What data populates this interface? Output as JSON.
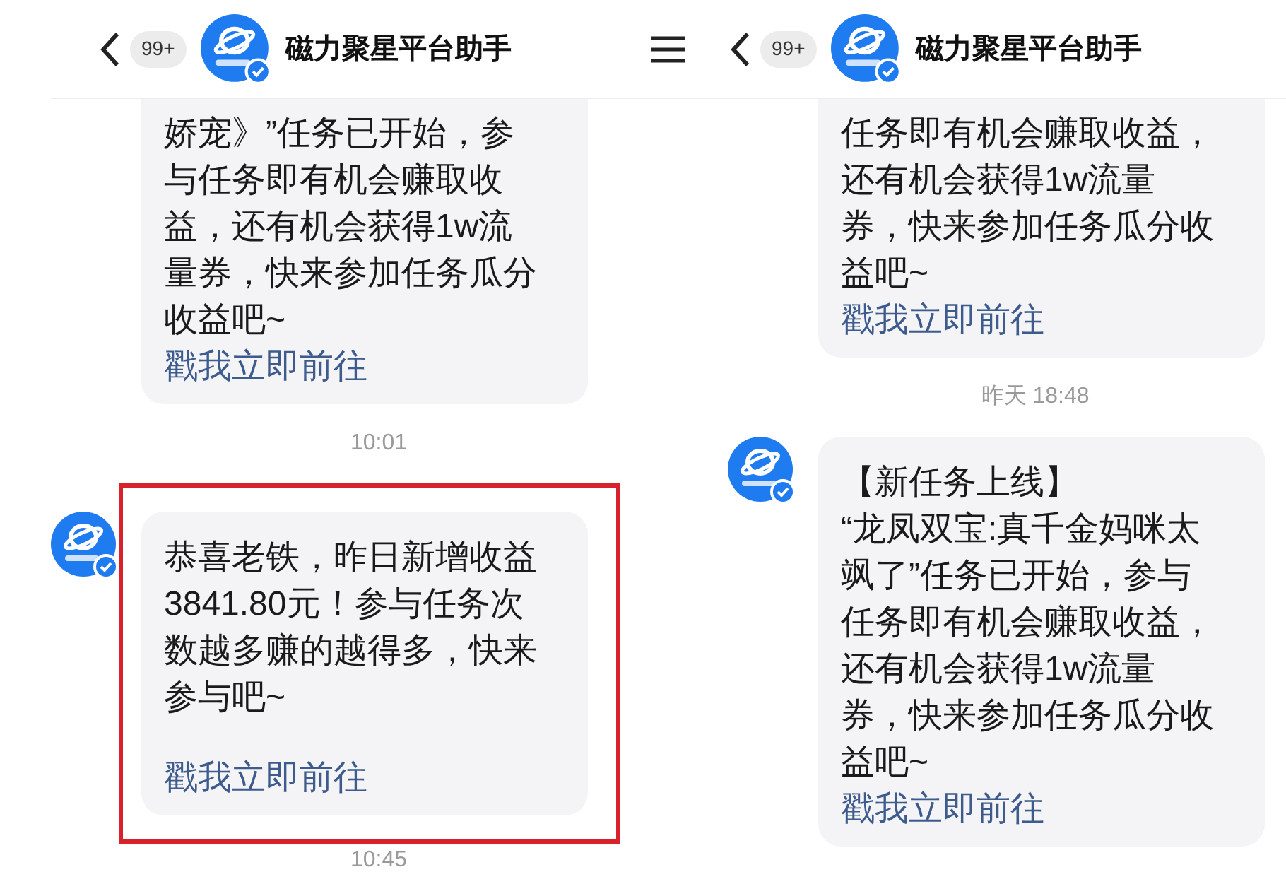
{
  "panels": [
    {
      "menu": false,
      "header": {
        "badge": "99+",
        "title": "磁力聚星平台助手"
      },
      "items": [
        {
          "kind": "message",
          "highlighted": false,
          "text": "娇宠》”任务已开始，参与任务即有机会赚取收益，还有机会获得1w流量券，快来参加任务瓜分收益吧~",
          "link": "戳我立即前往"
        },
        {
          "kind": "time",
          "text": "10:01"
        },
        {
          "kind": "message",
          "show_avatar": true,
          "highlighted": true,
          "text": "恭喜老铁，昨日新增收益3841.80元！参与任务次数越多赚的越得多，快来参与吧~",
          "link": "戳我立即前往"
        },
        {
          "kind": "time",
          "text": "10:45"
        }
      ]
    },
    {
      "menu": true,
      "header": {
        "badge": "99+",
        "title": "磁力聚星平台助手"
      },
      "items": [
        {
          "kind": "message",
          "highlighted": false,
          "text": "任务即有机会赚取收益，还有机会获得1w流量券，快来参加任务瓜分收益吧~",
          "link": "戳我立即前往"
        },
        {
          "kind": "time",
          "text": "昨天 18:48"
        },
        {
          "kind": "message",
          "show_avatar": true,
          "highlighted": false,
          "heading": "【新任务上线】",
          "text": "“龙凤双宝:真千金妈咪太飒了”任务已开始，参与任务即有机会赚取收益，还有机会获得1w流量券，快来参加任务瓜分收益吧~",
          "link": "戳我立即前往"
        }
      ]
    }
  ]
}
